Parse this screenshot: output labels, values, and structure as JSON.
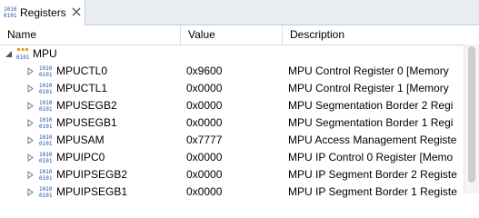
{
  "tab": {
    "title": "Registers",
    "icon": "register-binary-icon",
    "close_icon": "close-icon"
  },
  "columns": {
    "name": "Name",
    "value": "Value",
    "description": "Description"
  },
  "group": {
    "name": "MPU",
    "icon": "register-group-icon",
    "expanded": true
  },
  "registers": [
    {
      "name": "MPUCTL0",
      "value": "0x9600",
      "description": "MPU Control Register 0 [Memory"
    },
    {
      "name": "MPUCTL1",
      "value": "0x0000",
      "description": "MPU Control Register 1 [Memory"
    },
    {
      "name": "MPUSEGB2",
      "value": "0x0000",
      "description": "MPU Segmentation Border 2 Regi"
    },
    {
      "name": "MPUSEGB1",
      "value": "0x0000",
      "description": "MPU Segmentation Border 1 Regi"
    },
    {
      "name": "MPUSAM",
      "value": "0x7777",
      "description": "MPU Access Management Registe"
    },
    {
      "name": "MPUIPC0",
      "value": "0x0000",
      "description": "MPU IP Control 0 Register [Memo"
    },
    {
      "name": "MPUIPSEGB2",
      "value": "0x0000",
      "description": "MPU IP Segment Border 2 Registe"
    },
    {
      "name": "MPUIPSEGB1",
      "value": "0x0000",
      "description": "MPU IP Segment Border 1 Registe"
    }
  ],
  "colors": {
    "tabbar": "#e9ecf1",
    "header_border": "#d5d5d5",
    "icon_blue": "#1f4fa8"
  }
}
